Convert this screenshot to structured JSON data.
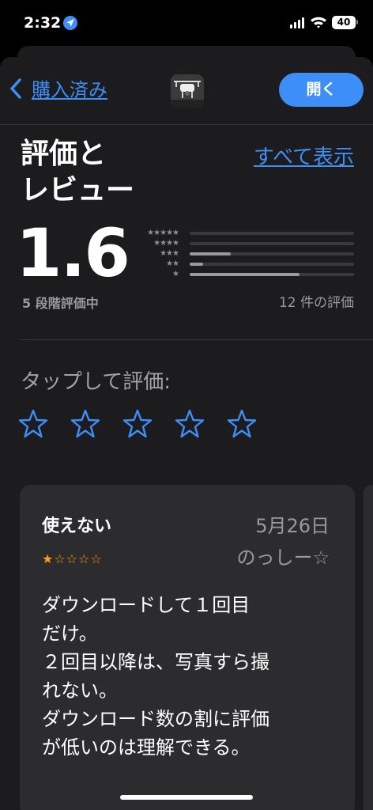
{
  "status_bar": {
    "time": "2:32",
    "battery": "40"
  },
  "nav": {
    "back_label": "購入済み",
    "open_label": "開く"
  },
  "ratings": {
    "title": "評価と\nレビュー",
    "see_all": "すべて表示",
    "average": "1.6",
    "out_of": "5 段階評価中",
    "count": "12 件の評価",
    "histogram": [
      {
        "stars": "★★★★★",
        "fraction": 0.0
      },
      {
        "stars": "★★★★",
        "fraction": 0.0
      },
      {
        "stars": "★★★",
        "fraction": 0.25
      },
      {
        "stars": "★★",
        "fraction": 0.08
      },
      {
        "stars": "★",
        "fraction": 0.67
      }
    ]
  },
  "tap_to_rate": {
    "label": "タップして評価:"
  },
  "review": {
    "title": "使えない",
    "date": "5月26日",
    "rating": 1,
    "stars_filled": "★",
    "stars_empty": "☆☆☆☆",
    "author": "のっしー☆",
    "body": "ダウンロードして１回目\nだけ。\n２回目以降は、写真すら撮\nれない。\nダウンロード数の割に評価\nが低いのは理解できる。"
  },
  "colors": {
    "accent": "#3e8ef7",
    "star": "#ff9f0a",
    "card": "#2c2c2e",
    "background": "#1c1c1e"
  }
}
